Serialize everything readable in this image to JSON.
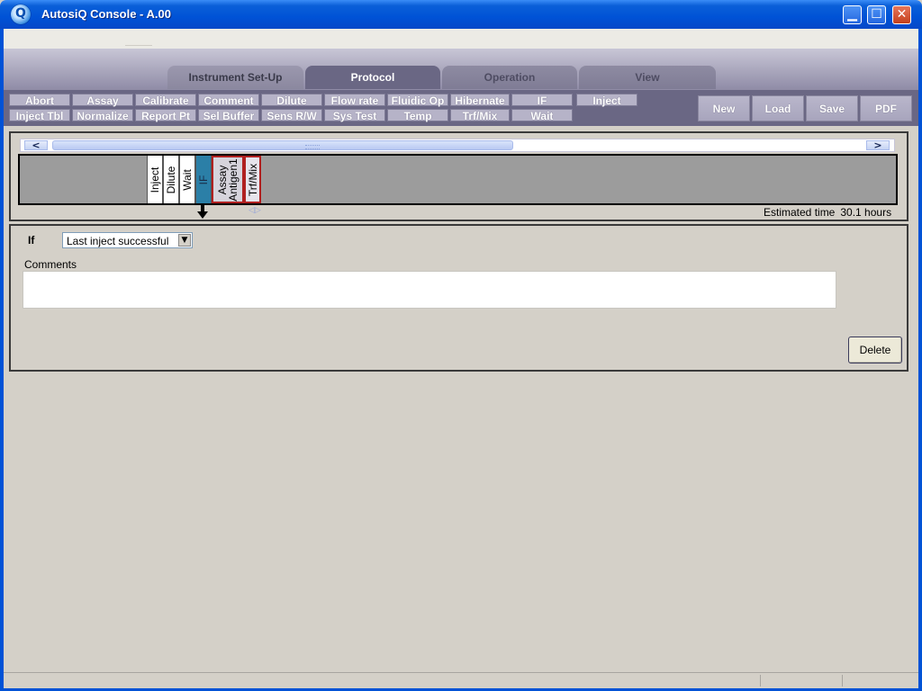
{
  "window": {
    "title": "AutosiQ Console - A.00",
    "app_icon_letter": "Q",
    "controls": {
      "minimize": "▁",
      "maximize": "☐",
      "close": "✕"
    }
  },
  "tabs": [
    {
      "label": "Instrument Set-Up",
      "state": "inactive"
    },
    {
      "label": "Protocol",
      "state": "active"
    },
    {
      "label": "Operation",
      "state": "disabled"
    },
    {
      "label": "View",
      "state": "disabled"
    }
  ],
  "toolbar": {
    "row1": [
      "Abort",
      "Assay",
      "Calibrate",
      "Comment",
      "Dilute",
      "Flow rate",
      "Fluidic Op",
      "Hibernate",
      "IF",
      "Inject"
    ],
    "row2": [
      "Inject Tbl",
      "Normalize",
      "Report Pt",
      "Sel Buffer",
      "Sens R/W",
      "Sys Test",
      "Temp",
      "Trf/Mix",
      "Wait"
    ],
    "file_buttons": [
      "New",
      "Load",
      "Save",
      "PDF"
    ]
  },
  "timeline": {
    "scroll_left": "<",
    "scroll_right": ">",
    "steps": [
      {
        "label": "Inject",
        "selected": false
      },
      {
        "label": "Dilute",
        "selected": false
      },
      {
        "label": "Wait",
        "selected": false
      },
      {
        "label": "IF",
        "selected": true
      },
      {
        "label": "Assay\nAntigen1",
        "selected": false
      },
      {
        "label": "Trf/Mix",
        "selected": false
      }
    ],
    "lr_arrows": "◁▷",
    "estimated_label": "Estimated time",
    "estimated_value": "30.1 hours"
  },
  "details": {
    "if_label": "If",
    "condition_value": "Last inject successful",
    "dropdown_glyph": "▼",
    "comments_label": "Comments",
    "comments_value": "",
    "delete_label": "Delete"
  },
  "colors": {
    "titlebar": "#0052d6",
    "toolbar": "#6a6784",
    "selected_step": "#2b7fa7",
    "panel_bg": "#d4d0c8"
  }
}
